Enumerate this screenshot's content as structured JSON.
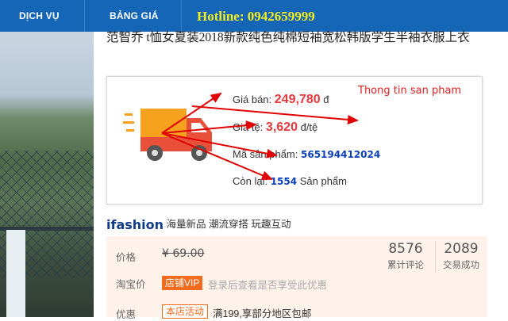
{
  "nav": {
    "item1": "DỊCH VỤ",
    "item2": "BẢNG GIÁ",
    "hotline": "Hotline: 0942659999"
  },
  "product": {
    "title": "范智乔 t恤女夏装2018新款纯色纯棉短袖宽松韩版学生半袖衣服上衣"
  },
  "info": {
    "note": "Thong tin san pham",
    "price_label": "Giá bán:",
    "price_value": "249,780",
    "price_unit": "đ",
    "rate_label": "Giá tệ:",
    "rate_value": "3,620",
    "rate_unit": "đ/tệ",
    "code_label": "Mã sản phẩm:",
    "code_value": "565194412024",
    "stock_label": "Còn lại:",
    "stock_value": "1554",
    "stock_unit": "Sản phẩm"
  },
  "ifashion": {
    "logo": "ifashion",
    "tagline": "海量新品 潮流穿搭 玩趣互动"
  },
  "panel": {
    "price_label": "价格",
    "old_price": "¥ 69.00",
    "taobao_label": "淘宝价",
    "vip_badge": "店铺VIP",
    "vip_note": "登录后查看是否享受此优惠",
    "promo_label": "优惠",
    "promo_badge": "本店活动",
    "promo_note": "满199,享部分地区包邮",
    "stat1_value": "8576",
    "stat1_label": "累计评论",
    "stat2_value": "2089",
    "stat2_label": "交易成功"
  },
  "colors": {
    "nav_bg": "#1666b8",
    "hotline": "#f5ee1d",
    "price": "#e4393c",
    "code_blue": "#0b3fb8",
    "truck_orange": "#f6a21e",
    "truck_red": "#e8503a",
    "arrow_red": "#e00000"
  }
}
